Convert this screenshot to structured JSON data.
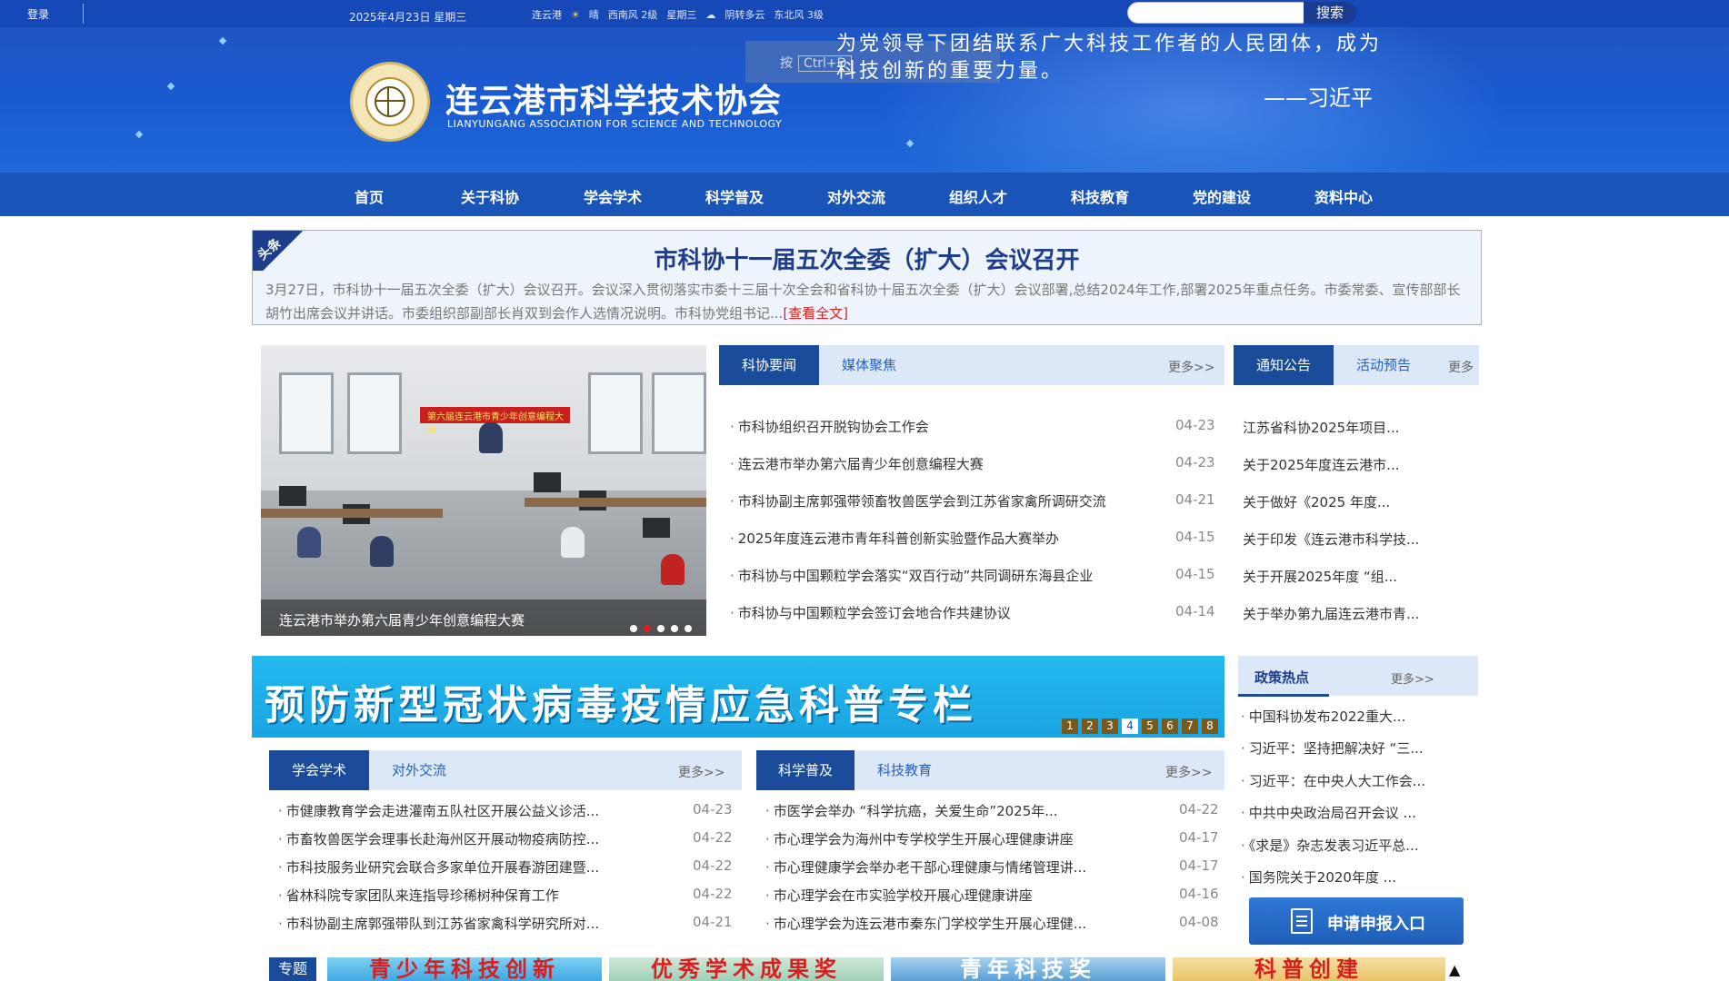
{
  "topbar": {
    "login": "登录",
    "date": "2025年4月23日 星期三",
    "weather": [
      "连云港",
      "晴",
      "",
      "西南风 2级",
      "星期三",
      "阴转多云",
      "",
      "东北风 3级"
    ],
    "search_placeholder": "",
    "search_button": "搜索"
  },
  "header": {
    "org_name": "连云港市科学技术协会",
    "org_name_en": "LIANYUNGANG ASSOCIATION FOR SCIENCE AND TECHNOLOGY",
    "quote_line1": "为党领导下团结联系广大科技工作者的人民团体，成为",
    "quote_line2": "科技创新的重要力量。",
    "quote_author": "——习近平",
    "tooltip_prefix": "按",
    "tooltip_key": "Ctrl+D"
  },
  "nav": [
    "首页",
    "关于科协",
    "学会学术",
    "科学普及",
    "对外交流",
    "组织人才",
    "科技教育",
    "党的建设",
    "资料中心"
  ],
  "headline": {
    "tag": "头条",
    "title": "市科协十一届五次全委（扩大）会议召开",
    "summary": "3月27日，市科协十一届五次全委（扩大）会议召开。会议深入贯彻落实市委十三届十次全会和省科协十届五次全委（扩大）会议部署,总结2024年工作,部署2025年重点任务。市委常委、宣传部部长胡竹出席会议并讲话。市委组织部副部长肖双到会作人选情况说明。市科协党组书记...",
    "more": "[查看全文]"
  },
  "slider": {
    "caption": "连云港市举办第六届青少年创意编程大赛",
    "classroom_banner": "第六届连云港市青少年创意编程大赛",
    "dot_count": 5,
    "active_dot": 2
  },
  "news_panel": {
    "tabs": [
      "科协要闻",
      "媒体聚焦"
    ],
    "more": "更多>>",
    "items": [
      {
        "title": "市科协组织召开脱钩协会工作会",
        "date": "04-23"
      },
      {
        "title": "连云港市举办第六届青少年创意编程大赛",
        "date": "04-23"
      },
      {
        "title": "市科协副主席郭强带领畜牧兽医学会到江苏省家禽所调研交流",
        "date": "04-21"
      },
      {
        "title": "2025年度连云港市青年科普创新实验暨作品大赛举办",
        "date": "04-15"
      },
      {
        "title": "市科协与中国颗粒学会落实“双百行动”共同调研东海县企业",
        "date": "04-15"
      },
      {
        "title": "市科协与中国颗粒学会签订会地合作共建协议",
        "date": "04-14"
      }
    ]
  },
  "notice_panel": {
    "tabs": [
      "通知公告",
      "活动预告"
    ],
    "more": "更多",
    "items": [
      "江苏省科协2025年项目...",
      "关于2025年度连云港市...",
      "关于做好《2025 年度...",
      "关于印发《连云港市科学技...",
      "关于开展2025年度 “组...",
      "关于举办第九届连云港市青..."
    ]
  },
  "covid_banner": {
    "text": "预防新型冠状病毒疫情应急科普专栏",
    "pages": [
      "1",
      "2",
      "3",
      "4",
      "5",
      "6",
      "7",
      "8"
    ],
    "active_page": 3
  },
  "policy": {
    "title": "政策热点",
    "more": "更多>>",
    "items": [
      "中国科协发布2022重大...",
      "习近平：坚持把解决好 “三...",
      "习近平：在中央人大工作会...",
      "中共中央政治局召开会议 ...",
      "《求是》杂志发表习近平总...",
      "国务院关于2020年度 ..."
    ],
    "apply_button": "申请申报入口"
  },
  "academic_panel": {
    "tabs": [
      "学会学术",
      "对外交流"
    ],
    "more": "更多>>",
    "items": [
      {
        "title": "市健康教育学会走进灌南五队社区开展公益义诊活...",
        "date": "04-23"
      },
      {
        "title": "市畜牧兽医学会理事长赴海州区开展动物疫病防控...",
        "date": "04-22"
      },
      {
        "title": "市科技服务业研究会联合多家单位开展春游团建暨...",
        "date": "04-22"
      },
      {
        "title": "省林科院专家团队来连指导珍稀树种保育工作",
        "date": "04-22"
      },
      {
        "title": "市科协副主席郭强带队到江苏省家禽科学研究所对...",
        "date": "04-21"
      }
    ]
  },
  "science_panel": {
    "tabs": [
      "科学普及",
      "科技教育"
    ],
    "more": "更多>>",
    "items": [
      {
        "title": "市医学会举办 “科学抗癌，关爱生命”2025年...",
        "date": "04-22"
      },
      {
        "title": "市心理学会为海州中专学校学生开展心理健康讲座",
        "date": "04-17"
      },
      {
        "title": "市心理健康学会举办老干部心理健康与情绪管理讲...",
        "date": "04-17"
      },
      {
        "title": "市心理学会在市实验学校开展心理健康讲座",
        "date": "04-16"
      },
      {
        "title": "市心理学会为连云港市秦东门学校学生开展心理健...",
        "date": "04-08"
      }
    ]
  },
  "topics": {
    "label": "专题",
    "items": [
      "青少年科技创新",
      "优秀学术成果奖",
      "青年科技奖",
      "科普创建"
    ],
    "scroll_top": "▲"
  },
  "colors": {
    "banner_blue": "#1e56c4",
    "nav_blue": "#1955b8",
    "tab_active": "#1a4b9a",
    "tab_bg": "#dce8f7",
    "accent_red": "#e02020"
  }
}
